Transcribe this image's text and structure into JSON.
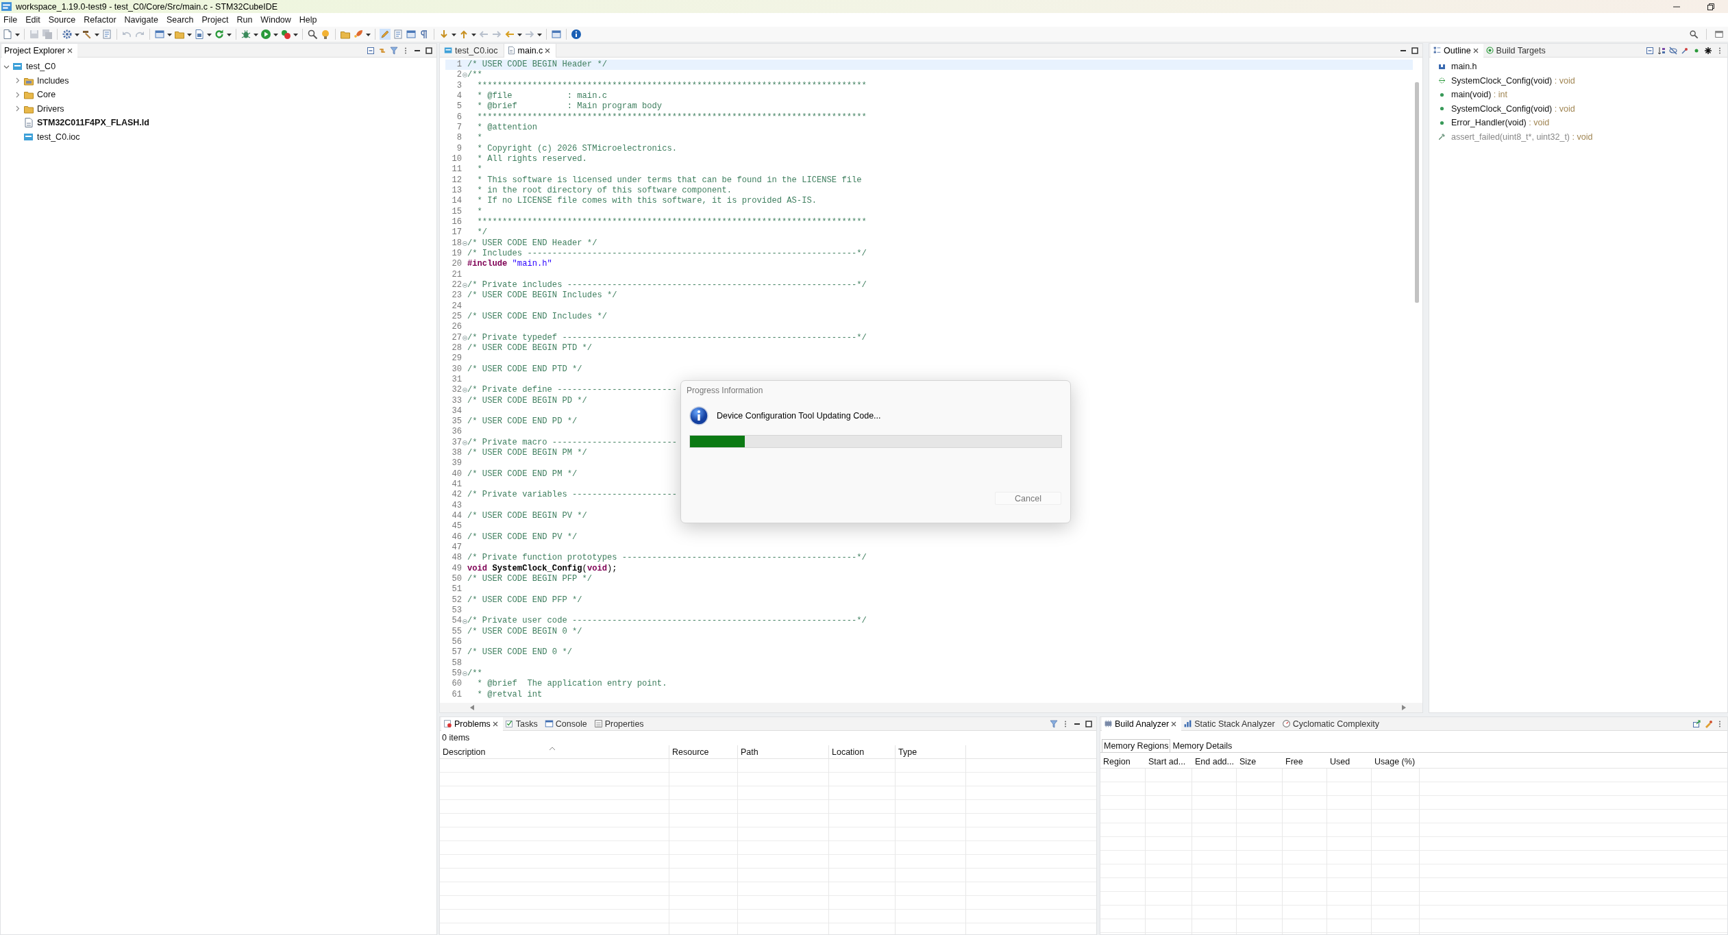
{
  "window": {
    "title": "workspace_1.19.0-test9 - test_C0/Core/Src/main.c - STM32CubeIDE"
  },
  "menu": [
    "File",
    "Edit",
    "Source",
    "Refactor",
    "Navigate",
    "Search",
    "Project",
    "Run",
    "Window",
    "Help"
  ],
  "project_explorer": {
    "tabs": [
      {
        "label": "Project Explorer",
        "selected": true,
        "closable": true
      }
    ],
    "tree": [
      {
        "label": "test_C0",
        "kind": "project",
        "bold": false,
        "expanded": true,
        "children": [
          {
            "label": "Includes",
            "kind": "includes",
            "bold": false,
            "expanded": false
          },
          {
            "label": "Core",
            "kind": "folder",
            "bold": false,
            "expanded": false
          },
          {
            "label": "Drivers",
            "kind": "folder",
            "bold": false,
            "expanded": false
          },
          {
            "label": "STM32C011F4PX_FLASH.ld",
            "kind": "linker",
            "bold": true
          },
          {
            "label": "test_C0.ioc",
            "kind": "ioc",
            "bold": false
          }
        ]
      }
    ]
  },
  "editor": {
    "tabs": [
      {
        "label": "test_C0.ioc",
        "kind": "ioc",
        "selected": false,
        "closable": false
      },
      {
        "label": "main.c",
        "kind": "source",
        "selected": true,
        "closable": true
      }
    ],
    "lines": [
      {
        "n": "1",
        "fold": false,
        "current": true,
        "parts": [
          {
            "kind": "comment",
            "text": "/* USER CODE BEGIN Header */"
          }
        ]
      },
      {
        "n": "2",
        "fold": true,
        "current": false,
        "parts": [
          {
            "kind": "comment",
            "text": "/**"
          }
        ]
      },
      {
        "n": "3",
        "fold": false,
        "current": false,
        "parts": [
          {
            "kind": "comment",
            "text": "  ******************************************************************************"
          }
        ]
      },
      {
        "n": "4",
        "fold": false,
        "current": false,
        "parts": [
          {
            "kind": "comment",
            "text": "  * @file           : main.c"
          }
        ]
      },
      {
        "n": "5",
        "fold": false,
        "current": false,
        "parts": [
          {
            "kind": "comment",
            "text": "  * @brief          : Main program body"
          }
        ]
      },
      {
        "n": "6",
        "fold": false,
        "current": false,
        "parts": [
          {
            "kind": "comment",
            "text": "  ******************************************************************************"
          }
        ]
      },
      {
        "n": "7",
        "fold": false,
        "current": false,
        "parts": [
          {
            "kind": "comment",
            "text": "  * @attention"
          }
        ]
      },
      {
        "n": "8",
        "fold": false,
        "current": false,
        "parts": [
          {
            "kind": "comment",
            "text": "  *"
          }
        ]
      },
      {
        "n": "9",
        "fold": false,
        "current": false,
        "parts": [
          {
            "kind": "comment",
            "text": "  * Copyright (c) 2026 STMicroelectronics."
          }
        ]
      },
      {
        "n": "10",
        "fold": false,
        "current": false,
        "parts": [
          {
            "kind": "comment",
            "text": "  * All rights reserved."
          }
        ]
      },
      {
        "n": "11",
        "fold": false,
        "current": false,
        "parts": [
          {
            "kind": "comment",
            "text": "  *"
          }
        ]
      },
      {
        "n": "12",
        "fold": false,
        "current": false,
        "parts": [
          {
            "kind": "comment",
            "text": "  * This software is licensed under terms that can be found in the LICENSE file"
          }
        ]
      },
      {
        "n": "13",
        "fold": false,
        "current": false,
        "parts": [
          {
            "kind": "comment",
            "text": "  * in the root directory of this software component."
          }
        ]
      },
      {
        "n": "14",
        "fold": false,
        "current": false,
        "parts": [
          {
            "kind": "comment",
            "text": "  * If no LICENSE file comes with this software, it is provided AS-IS."
          }
        ]
      },
      {
        "n": "15",
        "fold": false,
        "current": false,
        "parts": [
          {
            "kind": "comment",
            "text": "  *"
          }
        ]
      },
      {
        "n": "16",
        "fold": false,
        "current": false,
        "parts": [
          {
            "kind": "comment",
            "text": "  ******************************************************************************"
          }
        ]
      },
      {
        "n": "17",
        "fold": false,
        "current": false,
        "parts": [
          {
            "kind": "comment",
            "text": "  */"
          }
        ]
      },
      {
        "n": "18",
        "fold": true,
        "current": false,
        "parts": [
          {
            "kind": "comment",
            "text": "/* USER CODE END Header */"
          }
        ]
      },
      {
        "n": "19",
        "fold": false,
        "current": false,
        "parts": [
          {
            "kind": "comment",
            "text": "/* Includes ------------------------------------------------------------------*/"
          }
        ]
      },
      {
        "n": "20",
        "fold": false,
        "current": false,
        "parts": [
          {
            "kind": "keyword",
            "text": "#include"
          },
          {
            "kind": "string",
            "text": " \"main.h\""
          }
        ]
      },
      {
        "n": "21",
        "fold": false,
        "current": false
      },
      {
        "n": "22",
        "fold": true,
        "current": false,
        "parts": [
          {
            "kind": "comment",
            "text": "/* Private includes ----------------------------------------------------------*/"
          }
        ]
      },
      {
        "n": "23",
        "fold": false,
        "current": false,
        "parts": [
          {
            "kind": "comment",
            "text": "/* USER CODE BEGIN Includes */"
          }
        ]
      },
      {
        "n": "24",
        "fold": false,
        "current": false
      },
      {
        "n": "25",
        "fold": false,
        "current": false,
        "parts": [
          {
            "kind": "comment",
            "text": "/* USER CODE END Includes */"
          }
        ]
      },
      {
        "n": "26",
        "fold": false,
        "current": false
      },
      {
        "n": "27",
        "fold": true,
        "current": false,
        "parts": [
          {
            "kind": "comment",
            "text": "/* Private typedef -----------------------------------------------------------*/"
          }
        ]
      },
      {
        "n": "28",
        "fold": false,
        "current": false,
        "parts": [
          {
            "kind": "comment",
            "text": "/* USER CODE BEGIN PTD */"
          }
        ]
      },
      {
        "n": "29",
        "fold": false,
        "current": false
      },
      {
        "n": "30",
        "fold": false,
        "current": false,
        "parts": [
          {
            "kind": "comment",
            "text": "/* USER CODE END PTD */"
          }
        ]
      },
      {
        "n": "31",
        "fold": false,
        "current": false
      },
      {
        "n": "32",
        "fold": true,
        "current": false,
        "parts": [
          {
            "kind": "comment",
            "text": "/* Private define ------------------------"
          }
        ]
      },
      {
        "n": "33",
        "fold": false,
        "current": false,
        "parts": [
          {
            "kind": "comment",
            "text": "/* USER CODE BEGIN PD */"
          }
        ]
      },
      {
        "n": "34",
        "fold": false,
        "current": false
      },
      {
        "n": "35",
        "fold": false,
        "current": false,
        "parts": [
          {
            "kind": "comment",
            "text": "/* USER CODE END PD */"
          }
        ]
      },
      {
        "n": "36",
        "fold": false,
        "current": false
      },
      {
        "n": "37",
        "fold": true,
        "current": false,
        "parts": [
          {
            "kind": "comment",
            "text": "/* Private macro -------------------------"
          }
        ]
      },
      {
        "n": "38",
        "fold": false,
        "current": false,
        "parts": [
          {
            "kind": "comment",
            "text": "/* USER CODE BEGIN PM */"
          }
        ]
      },
      {
        "n": "39",
        "fold": false,
        "current": false
      },
      {
        "n": "40",
        "fold": false,
        "current": false,
        "parts": [
          {
            "kind": "comment",
            "text": "/* USER CODE END PM */"
          }
        ]
      },
      {
        "n": "41",
        "fold": false,
        "current": false
      },
      {
        "n": "42",
        "fold": false,
        "current": false,
        "parts": [
          {
            "kind": "comment",
            "text": "/* Private variables ---------------------"
          }
        ]
      },
      {
        "n": "43",
        "fold": false,
        "current": false
      },
      {
        "n": "44",
        "fold": false,
        "current": false,
        "parts": [
          {
            "kind": "comment",
            "text": "/* USER CODE BEGIN PV */"
          }
        ]
      },
      {
        "n": "45",
        "fold": false,
        "current": false
      },
      {
        "n": "46",
        "fold": false,
        "current": false,
        "parts": [
          {
            "kind": "comment",
            "text": "/* USER CODE END PV */"
          }
        ]
      },
      {
        "n": "47",
        "fold": false,
        "current": false
      },
      {
        "n": "48",
        "fold": false,
        "current": false,
        "parts": [
          {
            "kind": "comment",
            "text": "/* Private function prototypes -----------------------------------------------*/"
          }
        ]
      },
      {
        "n": "49",
        "fold": false,
        "current": false,
        "parts": [
          {
            "kind": "keyword",
            "text": "void"
          },
          {
            "kind": "function",
            "text": " SystemClock_Config"
          },
          {
            "kind": "plain",
            "text": "("
          },
          {
            "kind": "keyword",
            "text": "void"
          },
          {
            "kind": "plain",
            "text": ");"
          }
        ]
      },
      {
        "n": "50",
        "fold": false,
        "current": false,
        "parts": [
          {
            "kind": "comment",
            "text": "/* USER CODE BEGIN PFP */"
          }
        ]
      },
      {
        "n": "51",
        "fold": false,
        "current": false
      },
      {
        "n": "52",
        "fold": false,
        "current": false,
        "parts": [
          {
            "kind": "comment",
            "text": "/* USER CODE END PFP */"
          }
        ]
      },
      {
        "n": "53",
        "fold": false,
        "current": false
      },
      {
        "n": "54",
        "fold": true,
        "current": false,
        "parts": [
          {
            "kind": "comment",
            "text": "/* Private user code ---------------------------------------------------------*/"
          }
        ]
      },
      {
        "n": "55",
        "fold": false,
        "current": false,
        "parts": [
          {
            "kind": "comment",
            "text": "/* USER CODE BEGIN 0 */"
          }
        ]
      },
      {
        "n": "56",
        "fold": false,
        "current": false
      },
      {
        "n": "57",
        "fold": false,
        "current": false,
        "parts": [
          {
            "kind": "comment",
            "text": "/* USER CODE END 0 */"
          }
        ]
      },
      {
        "n": "58",
        "fold": false,
        "current": false
      },
      {
        "n": "59",
        "fold": true,
        "current": false,
        "parts": [
          {
            "kind": "comment",
            "text": "/**"
          }
        ]
      },
      {
        "n": "60",
        "fold": false,
        "current": false,
        "parts": [
          {
            "kind": "comment",
            "text": "  * @brief  The application entry point."
          }
        ]
      },
      {
        "n": "61",
        "fold": false,
        "current": false,
        "parts": [
          {
            "kind": "comment",
            "text": "  * @retval int"
          }
        ]
      }
    ]
  },
  "outline": {
    "tabs": [
      {
        "label": "Outline",
        "kind": "outline",
        "selected": true,
        "closable": true
      },
      {
        "label": "Build Targets",
        "kind": "targets",
        "selected": false,
        "closable": false
      }
    ],
    "items": [
      {
        "kind": "include",
        "name": "main.h",
        "disabled": false
      },
      {
        "kind": "prototype",
        "name": "SystemClock_Config(void)",
        "type": " : void",
        "disabled": false
      },
      {
        "kind": "function",
        "name": "main(void)",
        "type": " : int",
        "disabled": false
      },
      {
        "kind": "function",
        "name": "SystemClock_Config(void)",
        "type": " : void",
        "disabled": false
      },
      {
        "kind": "function",
        "name": "Error_Handler(void)",
        "type": " : void",
        "disabled": false
      },
      {
        "kind": "inactive",
        "name": "assert_failed(uint8_t*, uint32_t)",
        "type": " : void",
        "disabled": true
      }
    ]
  },
  "problems": {
    "tabs": [
      {
        "label": "Problems",
        "kind": "problems",
        "selected": true,
        "closable": true
      },
      {
        "label": "Tasks",
        "kind": "tasks",
        "selected": false,
        "closable": false
      },
      {
        "label": "Console",
        "kind": "console",
        "selected": false,
        "closable": false
      },
      {
        "label": "Properties",
        "kind": "properties",
        "selected": false,
        "closable": false
      }
    ],
    "summary": "0 items",
    "columns": [
      "Description",
      "Resource",
      "Path",
      "Location",
      "Type"
    ]
  },
  "build_analyzer": {
    "tabs": [
      {
        "label": "Build Analyzer",
        "kind": "analyzer",
        "selected": true,
        "closable": true
      },
      {
        "label": "Static Stack Analyzer",
        "kind": "stack",
        "selected": false,
        "closable": false
      },
      {
        "label": "Cyclomatic Complexity",
        "kind": "complexity",
        "selected": false,
        "closable": false
      }
    ],
    "subtabs": [
      {
        "label": "Memory Regions",
        "selected": true
      },
      {
        "label": "Memory Details",
        "selected": false
      }
    ],
    "columns": [
      "Region",
      "Start ad...",
      "End add...",
      "Size",
      "Free",
      "Used",
      "Usage (%)"
    ]
  },
  "dialog": {
    "title": "Progress Information",
    "message": "Device Configuration Tool Updating Code...",
    "level": 0.148,
    "button": {
      "label": "Cancel",
      "disabled": true
    }
  }
}
